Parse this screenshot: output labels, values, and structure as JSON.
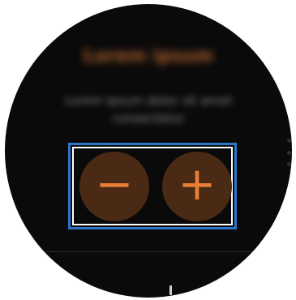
{
  "screen": {
    "title": "Lorem ipsum",
    "message": "Lorem ipsum dolor sit amet consectetur"
  },
  "controls": {
    "minus_label": "−",
    "plus_label": "+",
    "accent_color": "#e87f35",
    "button_color": "#4a2a14",
    "highlight_color": "#2b76c9"
  },
  "icons": {
    "more_options": "more-vertical-icon"
  }
}
